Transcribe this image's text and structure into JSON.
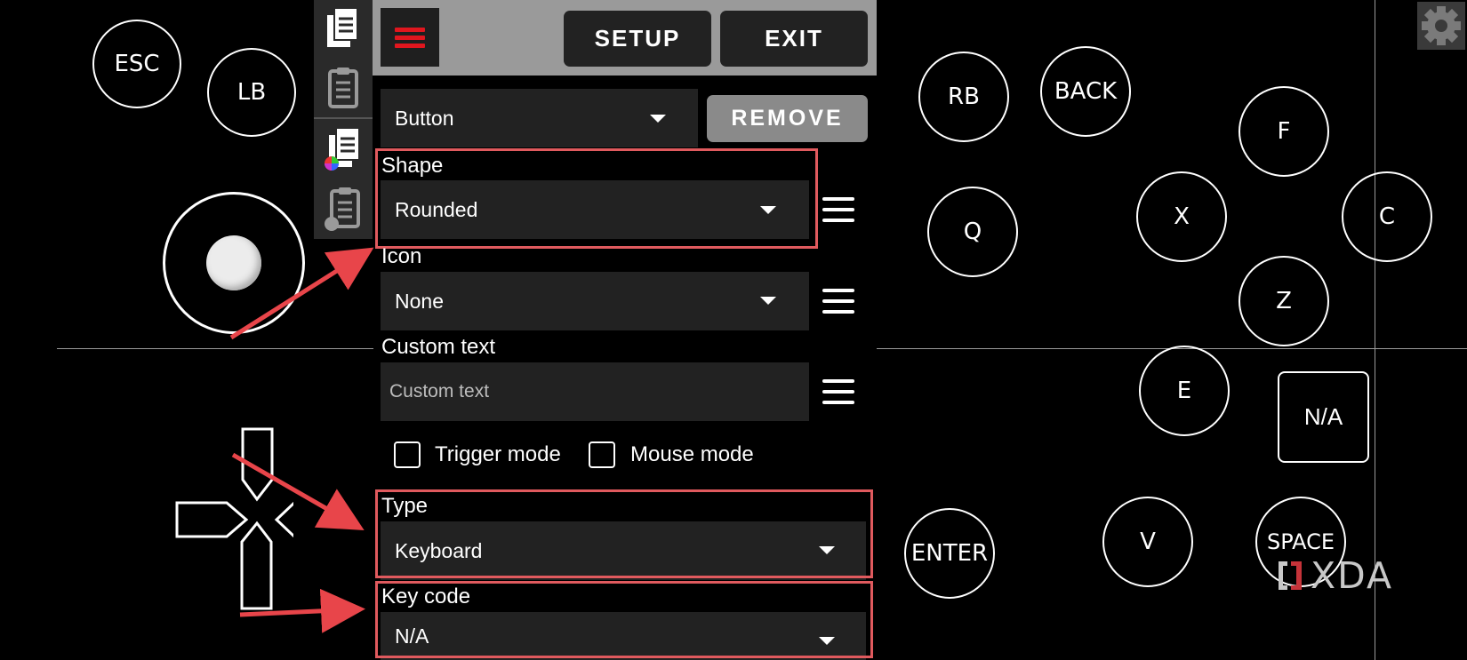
{
  "left_controls": {
    "esc": "ESC",
    "lb": "LB"
  },
  "sidebar": {
    "icons": [
      "copy-icon",
      "clipboard-icon",
      "copy-color-icon",
      "clipboard-color-icon"
    ]
  },
  "toolbar": {
    "setup_label": "SETUP",
    "exit_label": "EXIT"
  },
  "editor": {
    "element_type": "Button",
    "remove_label": "REMOVE",
    "shape_label": "Shape",
    "shape_value": "Rounded",
    "icon_label": "Icon",
    "icon_value": "None",
    "custom_text_label": "Custom text",
    "custom_text_placeholder": "Custom text",
    "trigger_mode_label": "Trigger mode",
    "mouse_mode_label": "Mouse mode",
    "type_label": "Type",
    "type_value": "Keyboard",
    "key_code_label": "Key code",
    "key_code_value": "N/A"
  },
  "right_controls": {
    "rb": "RB",
    "back": "BACK",
    "f": "F",
    "q": "Q",
    "x": "X",
    "c": "C",
    "z": "Z",
    "e": "E",
    "na": "N/A",
    "enter": "ENTER",
    "v": "V",
    "space": "SPACE"
  },
  "watermark": {
    "text": "XDA"
  },
  "colors": {
    "background": "#000000",
    "highlight": "#e05a5e",
    "menu_accent": "#e0161e",
    "panel_bar": "#9a9a9a",
    "field_bg": "#222222"
  }
}
